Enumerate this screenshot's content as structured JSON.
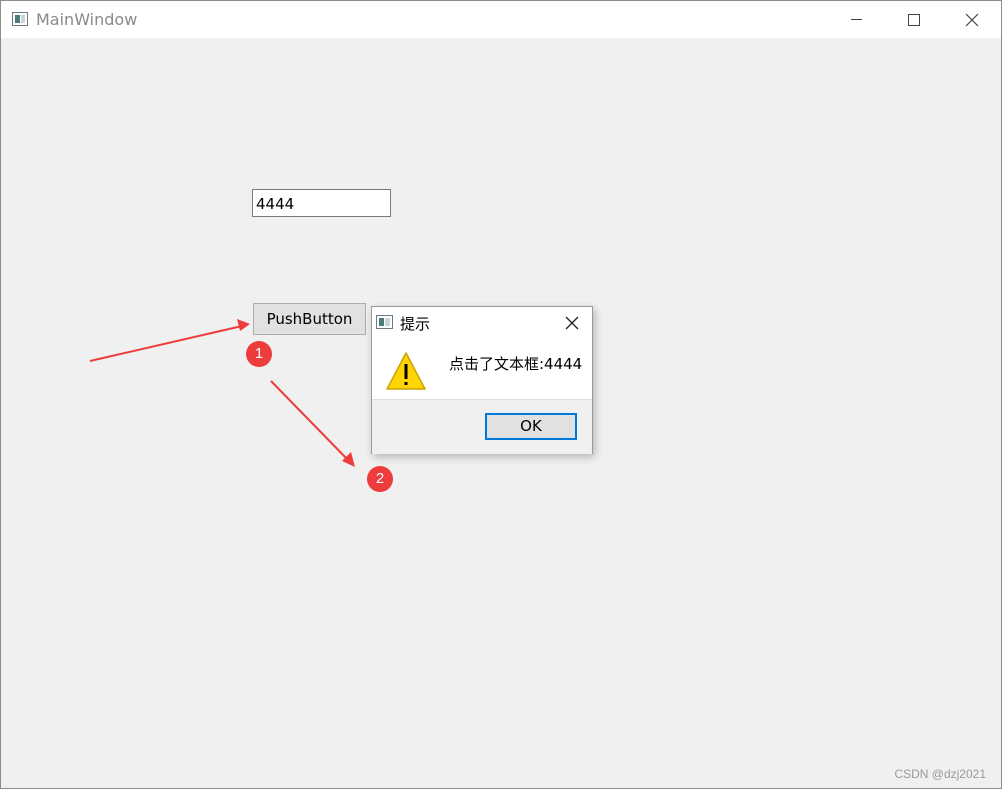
{
  "window": {
    "title": "MainWindow",
    "icon": "app-window-icon",
    "controls": [
      "minimize-icon",
      "maximize-icon",
      "close-icon"
    ]
  },
  "main": {
    "text_input_value": "4444",
    "push_button_label": "PushButton"
  },
  "dialog": {
    "title": "提示",
    "message": "点击了文本框:4444",
    "icon": "warning-icon",
    "ok_label": "OK"
  },
  "annotations": {
    "badge_1": "1",
    "badge_2": "2",
    "arrow_color": "#ee3b3b"
  },
  "watermark": "CSDN @dzj2021",
  "colors": {
    "focus_border": "#0078d7",
    "warning_fill": "#ffd400",
    "badge_red": "#ee3b3b"
  }
}
